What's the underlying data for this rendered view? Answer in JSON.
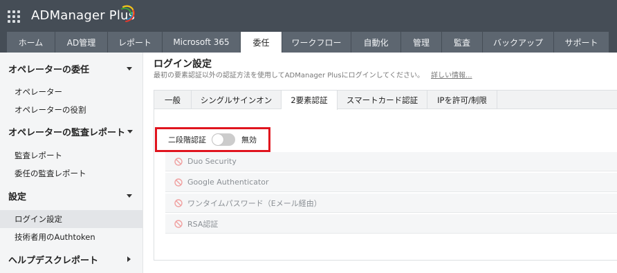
{
  "app": {
    "name": "ADManager Plus"
  },
  "nav": {
    "tabs": [
      {
        "label": "ホーム"
      },
      {
        "label": "AD管理"
      },
      {
        "label": "レポート"
      },
      {
        "label": "Microsoft 365"
      },
      {
        "label": "委任",
        "active": true
      },
      {
        "label": "ワークフロー"
      },
      {
        "label": "自動化"
      },
      {
        "label": "管理"
      },
      {
        "label": "監査"
      },
      {
        "label": "バックアップ"
      },
      {
        "label": "サポート"
      }
    ]
  },
  "sidebar": {
    "sections": [
      {
        "label": "オペレーターの委任",
        "items": [
          "オペレーター",
          "オペレーターの役割"
        ]
      },
      {
        "label": "オペレーターの監査レポート",
        "items": [
          "監査レポート",
          "委任の監査レポート"
        ]
      },
      {
        "label": "設定",
        "items": [
          "ログイン設定",
          "技術者用のAuthtoken"
        ],
        "active_item": "ログイン設定"
      },
      {
        "label": "ヘルプデスクレポート",
        "items": []
      }
    ]
  },
  "main": {
    "title": "ログイン設定",
    "description": "最初の要素認証以外の認証方法を使用してADManager Plusにログインしてください。",
    "more_link": "詳しい情報...",
    "subtabs": [
      {
        "label": "一般"
      },
      {
        "label": "シングルサインオン"
      },
      {
        "label": "2要素認証",
        "active": true
      },
      {
        "label": "スマートカード認証"
      },
      {
        "label": "IPを許可/制限"
      }
    ],
    "two_factor": {
      "label": "二段階認証",
      "enabled": false,
      "status": "無効"
    },
    "options": [
      {
        "label": "Duo Security"
      },
      {
        "label": "Google Authenticator"
      },
      {
        "label": "ワンタイムパスワード（Eメール経由）"
      },
      {
        "label": "RSA認証"
      }
    ]
  },
  "colors": {
    "header_bg": "#454d56",
    "tab_bg": "#5d6670",
    "highlight_border": "#e0141e",
    "logo_yellow": "#f5c518",
    "logo_red": "#e23a2e",
    "logo_green": "#3aa935",
    "logo_blue": "#1e88c8"
  },
  "icons": {
    "apps": "grid-icon",
    "option_status": "block-icon",
    "section_collapse": "caret-down-icon",
    "section_expand": "caret-right-icon"
  }
}
